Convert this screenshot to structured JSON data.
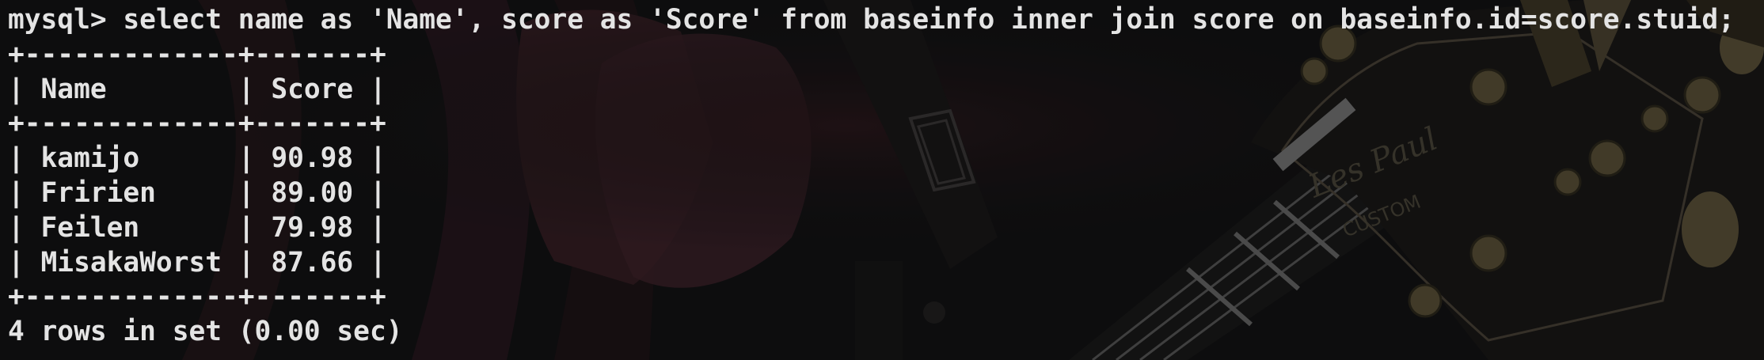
{
  "terminal": {
    "prompt": "mysql>",
    "command": "select name as 'Name', score as 'Score' from baseinfo inner join score on baseinfo.id=score.stuid;",
    "table": {
      "border": "+-------------+-------+",
      "header_row": "| Name        | Score |",
      "rows": [
        "| kamijo      | 90.98 |",
        "| Fririen     | 89.00 |",
        "| Feilen      | 79.98 |",
        "| MisakaWorst | 87.66 |"
      ]
    },
    "result_summary": "4 rows in set (0.00 sec)"
  },
  "colors": {
    "background": "#0d0d0f",
    "text": "#e4e4e4"
  },
  "wallpaper": {
    "icon": "anime-guitar-wallpaper-icon",
    "engraving_script": "Les Paul",
    "engraving_label": "CUSTOM"
  }
}
